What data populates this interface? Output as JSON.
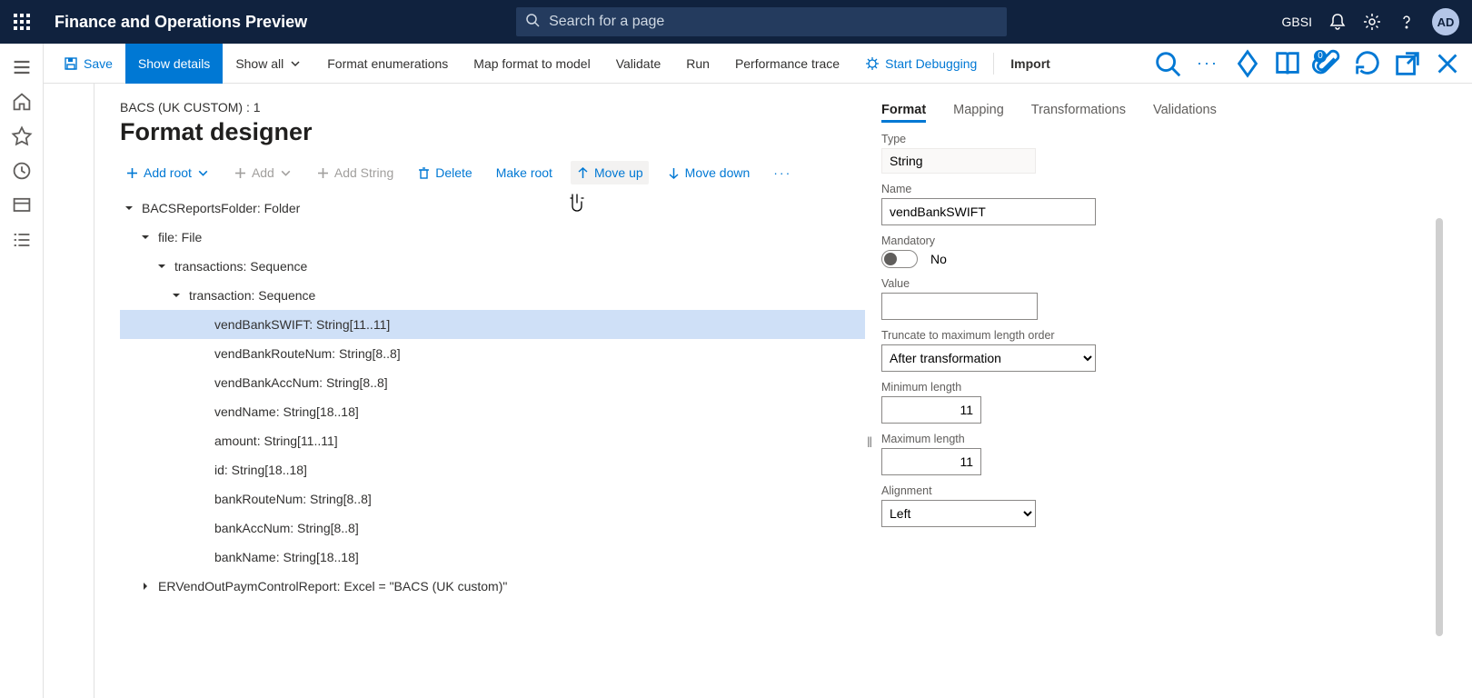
{
  "top": {
    "product": "Finance and Operations Preview",
    "search_placeholder": "Search for a page",
    "company": "GBSI",
    "avatar": "AD"
  },
  "commandbar": {
    "save": "Save",
    "show_details": "Show details",
    "show_all": "Show all",
    "format_enum": "Format enumerations",
    "map_format": "Map format to model",
    "validate": "Validate",
    "run": "Run",
    "perf_trace": "Performance trace",
    "start_debug": "Start Debugging",
    "import": "Import",
    "attachments_count": "0"
  },
  "page": {
    "breadcrumb": "BACS (UK CUSTOM) : 1",
    "title": "Format designer"
  },
  "designer_toolbar": {
    "add_root": "Add root",
    "add": "Add",
    "add_string": "Add String",
    "delete": "Delete",
    "make_root": "Make root",
    "move_up": "Move up",
    "move_down": "Move down"
  },
  "tree": [
    {
      "depth": 0,
      "caret": "down",
      "label": "BACSReportsFolder: Folder"
    },
    {
      "depth": 1,
      "caret": "down",
      "label": "file: File"
    },
    {
      "depth": 2,
      "caret": "down",
      "label": "transactions: Sequence"
    },
    {
      "depth": 3,
      "caret": "down",
      "label": "transaction: Sequence"
    },
    {
      "depth": 4,
      "caret": "",
      "label": "vendBankSWIFT: String[11..11]",
      "selected": true
    },
    {
      "depth": 4,
      "caret": "",
      "label": "vendBankRouteNum: String[8..8]"
    },
    {
      "depth": 4,
      "caret": "",
      "label": "vendBankAccNum: String[8..8]"
    },
    {
      "depth": 4,
      "caret": "",
      "label": "vendName: String[18..18]"
    },
    {
      "depth": 4,
      "caret": "",
      "label": "amount: String[11..11]"
    },
    {
      "depth": 4,
      "caret": "",
      "label": "id: String[18..18]"
    },
    {
      "depth": 4,
      "caret": "",
      "label": "bankRouteNum: String[8..8]"
    },
    {
      "depth": 4,
      "caret": "",
      "label": "bankAccNum: String[8..8]"
    },
    {
      "depth": 4,
      "caret": "",
      "label": "bankName: String[18..18]"
    },
    {
      "depth": 1,
      "caret": "right",
      "label": "ERVendOutPaymControlReport: Excel = \"BACS (UK custom)\""
    }
  ],
  "tabs": {
    "format": "Format",
    "mapping": "Mapping",
    "transformations": "Transformations",
    "validations": "Validations"
  },
  "form": {
    "type_label": "Type",
    "type_value": "String",
    "name_label": "Name",
    "name_value": "vendBankSWIFT",
    "mandatory_label": "Mandatory",
    "mandatory_value": "No",
    "value_label": "Value",
    "value_value": "",
    "truncate_label": "Truncate to maximum length order",
    "truncate_value": "After transformation",
    "minlen_label": "Minimum length",
    "minlen_value": "11",
    "maxlen_label": "Maximum length",
    "maxlen_value": "11",
    "align_label": "Alignment",
    "align_value": "Left"
  }
}
